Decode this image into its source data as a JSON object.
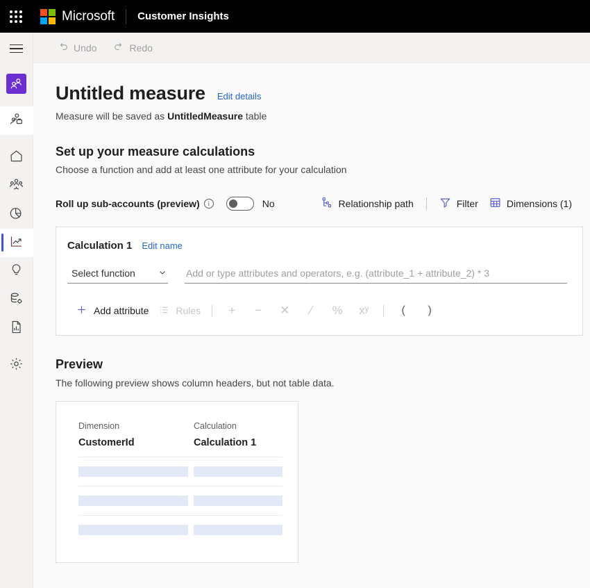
{
  "suite_bar": {
    "waffle_icon": "waffle-grid-icon",
    "brand": "Microsoft",
    "app_name": "Customer Insights"
  },
  "command_bar": {
    "undo": {
      "label": "Undo",
      "icon": "undo-arrow-icon"
    },
    "redo": {
      "label": "Redo",
      "icon": "redo-arrow-icon"
    }
  },
  "rail": {
    "hamburger_icon": "hamburger-menu-icon",
    "items": [
      {
        "name": "sidebar-item-audience-insights",
        "icon": "two-people-icon",
        "state": "active-purple"
      },
      {
        "name": "sidebar-item-customer-profile",
        "icon": "person-with-badge-icon",
        "state": "white"
      },
      {
        "name": "sidebar-item-home",
        "icon": "home-icon",
        "state": ""
      },
      {
        "name": "sidebar-item-segments",
        "icon": "people-group-icon",
        "state": ""
      },
      {
        "name": "sidebar-item-measures-pie",
        "icon": "pie-chart-icon",
        "state": ""
      },
      {
        "name": "sidebar-item-measures",
        "icon": "trending-chart-icon",
        "state": "selected"
      },
      {
        "name": "sidebar-item-enrichment",
        "icon": "lightbulb-icon",
        "state": ""
      },
      {
        "name": "sidebar-item-data",
        "icon": "database-gear-icon",
        "state": ""
      },
      {
        "name": "sidebar-item-reports",
        "icon": "report-document-icon",
        "state": ""
      },
      {
        "name": "sidebar-item-admin",
        "icon": "gear-icon",
        "state": ""
      }
    ]
  },
  "page": {
    "title": "Untitled measure",
    "edit_details_link": "Edit details",
    "subtitle_prefix": "Measure will be saved as ",
    "subtitle_table": "UntitledMeasure",
    "subtitle_suffix": " table",
    "section_title": "Set up your measure calculations",
    "section_subtitle": "Choose a function and add at least one attribute for your calculation"
  },
  "controls": {
    "rollup_label": "Roll up sub-accounts (preview)",
    "info_icon": "info-circle-icon",
    "toggle_state": "No",
    "toggle_on": false,
    "relationship_path": {
      "label": "Relationship path",
      "icon": "relationship-path-icon"
    },
    "filter": {
      "label": "Filter",
      "icon": "funnel-filter-icon"
    },
    "dimensions": {
      "label": "Dimensions (1)",
      "icon": "table-grid-icon"
    }
  },
  "calculation": {
    "name": "Calculation 1",
    "edit_name_link": "Edit name",
    "select_function_label": "Select function",
    "chevron_icon": "chevron-down-icon",
    "expression_placeholder": "Add or type attributes and operators, e.g. (attribute_1 + attribute_2) * 3",
    "expression_value": "",
    "add_attribute_label": "Add attribute",
    "add_attribute_icon": "plus-icon",
    "rules_label": "Rules",
    "rules_icon": "bulleted-list-icon",
    "operators": [
      "+",
      "−",
      "✕",
      "∕",
      "%",
      "xʸ"
    ],
    "parens": [
      "(",
      ")"
    ]
  },
  "preview": {
    "title": "Preview",
    "subtitle": "The following preview shows column headers, but not table data.",
    "columns": [
      {
        "hint": "Dimension",
        "name": "CustomerId"
      },
      {
        "hint": "Calculation",
        "name": "Calculation 1"
      }
    ],
    "placeholder_row_count": 3
  },
  "colors": {
    "accent_purple": "#6b2fd1",
    "selection_blue": "#3a56d4",
    "link_blue": "#2266cc",
    "icon_blue": "#4a52c4",
    "placeholder_bar": "#e4e9f7",
    "suite_bar_bg": "#000000",
    "rail_bg": "#f3f2f1",
    "page_bg": "#fafafa"
  }
}
